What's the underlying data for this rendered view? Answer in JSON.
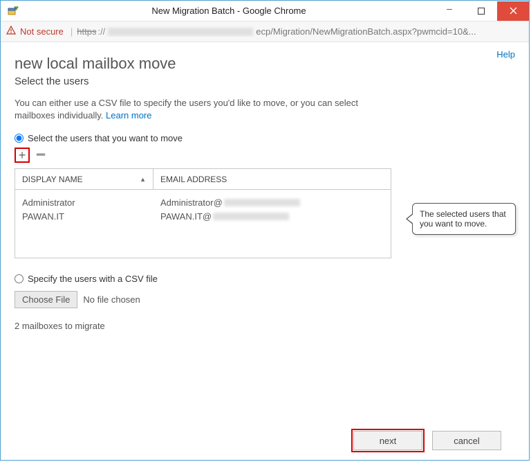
{
  "window": {
    "title": "New Migration Batch - Google Chrome"
  },
  "addressbar": {
    "not_secure": "Not secure",
    "https": "https",
    "path_tail": "ecp/Migration/NewMigrationBatch.aspx?pwmcid=10&..."
  },
  "help": "Help",
  "page": {
    "title": "new local mailbox move",
    "subtitle": "Select the users",
    "desc_pre": "You can either use a CSV file to specify the users you'd like to move, or you can select mailboxes individually. ",
    "learn_more": "Learn more"
  },
  "options": {
    "select_users_label": "Select the users that you want to move",
    "csv_label": "Specify the users with a CSV file",
    "selected": "select"
  },
  "table": {
    "col_display": "DISPLAY NAME",
    "col_email": "EMAIL ADDRESS",
    "rows": [
      {
        "name": "Administrator",
        "email_prefix": "Administrator@"
      },
      {
        "name": "PAWAN.IT",
        "email_prefix": "PAWAN.IT@"
      }
    ]
  },
  "callout": "The selected users that you want to move.",
  "file": {
    "button": "Choose File",
    "status": "No file chosen"
  },
  "summary": "2 mailboxes to migrate",
  "buttons": {
    "next": "next",
    "cancel": "cancel"
  }
}
